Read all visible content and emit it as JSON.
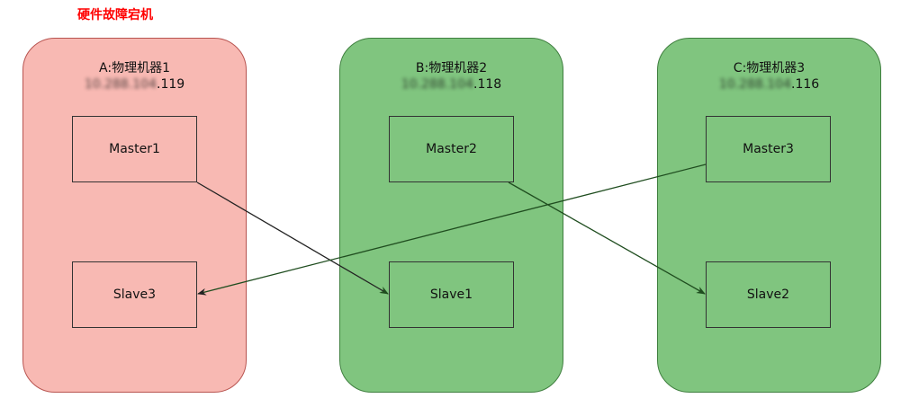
{
  "title": "硬件故障宕机",
  "machines": [
    {
      "id": "A",
      "name": "A:物理机器1",
      "ip_visible_suffix": ".119",
      "status": "failed",
      "color": "#f8b9b3"
    },
    {
      "id": "B",
      "name": "B:物理机器2",
      "ip_visible_suffix": ".118",
      "status": "ok",
      "color": "#80c57f"
    },
    {
      "id": "C",
      "name": "C:物理机器3",
      "ip_visible_suffix": ".116",
      "status": "ok",
      "color": "#80c57f"
    }
  ],
  "nodes": {
    "master1": "Master1",
    "slave3": "Slave3",
    "master2": "Master2",
    "slave1": "Slave1",
    "master3": "Master3",
    "slave2": "Slave2"
  },
  "replication": [
    {
      "from": "Master1",
      "to": "Slave1"
    },
    {
      "from": "Master2",
      "to": "Slave2"
    },
    {
      "from": "Master3",
      "to": "Slave3"
    }
  ],
  "colors": {
    "title_red": "#ff0000",
    "failed_fill": "#f8b9b3",
    "ok_fill": "#80c57f",
    "arrow_failed": "#222222",
    "arrow_ok": "#1f4d1f"
  }
}
